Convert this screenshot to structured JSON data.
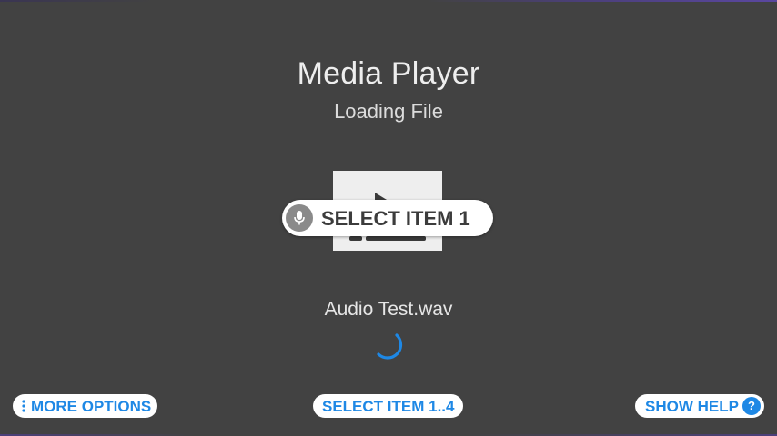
{
  "header": {
    "title": "Media Player",
    "subtitle": "Loading File"
  },
  "media": {
    "thumbnail_icon": "video-file-icon"
  },
  "voice_prompt": {
    "icon": "microphone-icon",
    "label": "SELECT ITEM 1"
  },
  "file": {
    "name": "Audio Test.wav",
    "loading_icon": "loading-spinner-icon"
  },
  "footer": {
    "more_options": {
      "icon": "vertical-dots-icon",
      "label": "MORE OPTIONS"
    },
    "select_range": {
      "label": "SELECT ITEM 1..4"
    },
    "show_help": {
      "label": "SHOW HELP",
      "icon": "question-mark-icon",
      "icon_glyph": "?"
    }
  },
  "colors": {
    "background": "#424242",
    "accent": "#1e88e5",
    "chip_background": "#ffffff",
    "text": "#e6e6e6"
  }
}
